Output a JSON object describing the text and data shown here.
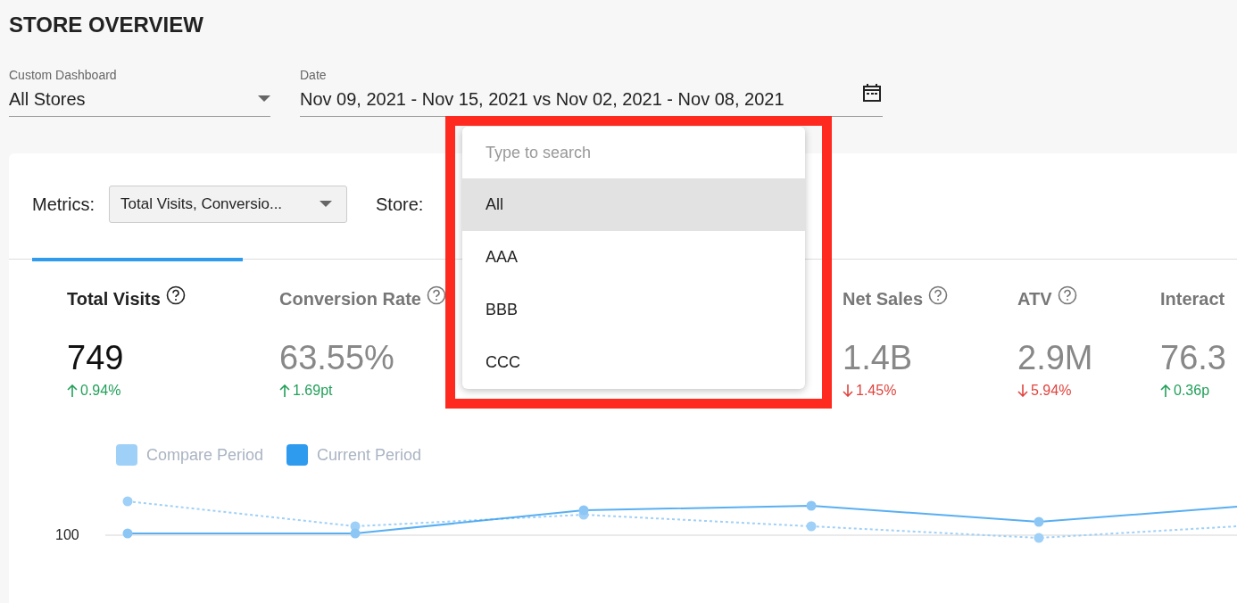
{
  "page_title": "STORE OVERVIEW",
  "filters": [
    {
      "label": "Custom Dashboard",
      "value": "All Stores",
      "kind": "select"
    },
    {
      "label": "Date",
      "value": "Nov 09, 2021 - Nov 15, 2021 vs Nov 02, 2021 - Nov 08, 2021",
      "kind": "date"
    }
  ],
  "toolbar": {
    "metrics_label": "Metrics:",
    "metrics_value": "Total Visits, Conversio...",
    "store_label": "Store:"
  },
  "metrics": [
    {
      "name": "Total Visits",
      "value": "749",
      "change": "0.94%",
      "increase": true,
      "selected": true
    },
    {
      "name": "Conversion Rate",
      "value": "63.55%",
      "change": "1.69pt",
      "increase": true,
      "selected": false
    },
    {
      "name": "Net Sales",
      "value": "1.4B",
      "change": "1.45%",
      "increase": false,
      "selected": false
    },
    {
      "name": "ATV",
      "value": "2.9M",
      "change": "5.94%",
      "increase": false,
      "selected": false
    },
    {
      "name": "Interact",
      "value": "76.3",
      "change": "0.36p",
      "increase": true,
      "selected": false
    }
  ],
  "legend": [
    {
      "label": "Compare Period",
      "color": "#9fd0f7"
    },
    {
      "label": "Current Period",
      "color": "#2f9bef"
    }
  ],
  "chart_axis_label": "100",
  "store_dropdown": {
    "placeholder": "Type to search",
    "options": [
      {
        "label": "All",
        "selected": true
      },
      {
        "label": "AAA",
        "selected": false
      },
      {
        "label": "BBB",
        "selected": false
      },
      {
        "label": "CCC",
        "selected": false
      }
    ]
  }
}
